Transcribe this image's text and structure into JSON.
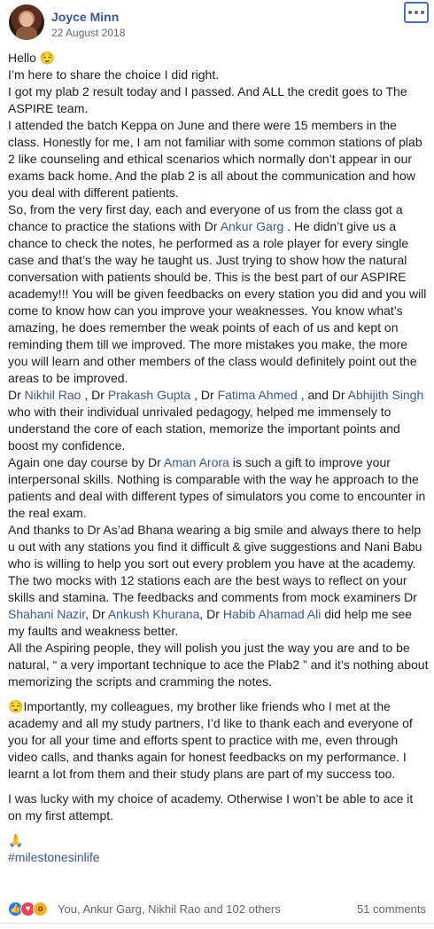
{
  "post": {
    "author": "Joyce Minn",
    "date": "22 August 2018",
    "paragraphs": [
      [
        {
          "t": "Hello "
        },
        {
          "t": "😌",
          "emoji": true
        }
      ],
      [
        {
          "t": "I’m here to share the choice I did right."
        }
      ],
      [
        {
          "t": "I got my plab 2 result today and I passed. And ALL the credit goes to The ASPIRE team."
        }
      ],
      [
        {
          "t": "I attended the batch Keppa on June and there were 15 members in the class. Honestly for me, I am not familiar with some common stations of plab 2 like counseling and ethical scenarios which normally don’t appear in our exams back home. And the plab 2 is all about the communication and how you deal with different patients."
        }
      ],
      [
        {
          "t": "So, from the very first day, each and everyone of us from the class got a chance to practice the stations with Dr "
        },
        {
          "t": "Ankur Garg",
          "link": true
        },
        {
          "t": " . He didn’t give us a chance to check the notes, he performed as a role player for every single case and that’s the way he taught us. Just trying to show how the natural conversation with patients should be. This is the best part of our ASPIRE academy!!! You will be given feedbacks on every station you did and you will come to know how can you improve your weaknesses. You know what’s amazing, he does remember the weak points of each of us and kept on reminding them till we improved. The more mistakes you make, the more you will learn and other members of the class would definitely point out the areas to be improved."
        }
      ],
      [
        {
          "t": "Dr "
        },
        {
          "t": "Nikhil Rao",
          "link": true
        },
        {
          "t": " , Dr "
        },
        {
          "t": "Prakash Gupta",
          "link": true
        },
        {
          "t": " , Dr "
        },
        {
          "t": "Fatima Ahmed",
          "link": true
        },
        {
          "t": " , and Dr "
        },
        {
          "t": "Abhijith Singh",
          "link": true
        },
        {
          "t": " who with their individual unrivaled pedagogy, helped me immensely to understand the core of each station, memorize the important points and boost my confidence."
        }
      ],
      [
        {
          "t": "Again one day course by Dr "
        },
        {
          "t": "Aman Arora",
          "link": true
        },
        {
          "t": " is such a gift to improve your interpersonal skills. Nothing is comparable with the way he approach to the patients and deal with different types of simulators you come to encounter in the real exam."
        }
      ],
      [
        {
          "t": "And thanks to Dr As’ad Bhana wearing a big smile and always there to help u out with any stations you find it difficult & give suggestions and Nani Babu who is willing to help you sort out every problem you have at the academy."
        }
      ],
      [
        {
          "t": "The two mocks with 12 stations each are the best ways to reflect on your skills and stamina. The feedbacks and comments from mock examiners Dr "
        },
        {
          "t": "Shahani Nazir",
          "link": true
        },
        {
          "t": ", Dr "
        },
        {
          "t": "Ankush Khurana",
          "link": true
        },
        {
          "t": ", Dr "
        },
        {
          "t": "Habib Ahamad Ali",
          "link": true
        },
        {
          "t": " did help me see my faults and weakness better."
        }
      ],
      [
        {
          "t": "All the Aspiring people, they will polish you just the way you are and to be natural, “ a very important technique to ace the Plab2 ” and it’s nothing about memorizing the scripts and cramming the notes."
        }
      ],
      [
        {
          "t": "😌",
          "emoji": true
        },
        {
          "t": "Importantly, my colleagues, my brother like friends who I met at the academy and all my study partners, I’d like to thank each and everyone of you for all your time and efforts spent to practice with me, even through video calls, and thanks again for honest feedbacks on my performance. I learnt a lot from them and their study plans are part of my success too."
        }
      ],
      [
        {
          "t": "I was lucky with my choice of academy. Otherwise I won’t be able to ace it on my first attempt."
        }
      ],
      [
        {
          "t": "🙏",
          "emoji": true
        }
      ],
      [
        {
          "t": "#milestonesinlife",
          "hashtag": true
        }
      ]
    ],
    "gap_before": [
      10,
      11,
      12
    ]
  },
  "footer": {
    "reactions_text": "You, Ankur Garg, Nikhil Rao and 102 others",
    "comments": "51 comments",
    "reaction_icons": [
      "like-icon",
      "love-icon",
      "wow-icon"
    ]
  },
  "colors": {
    "link": "#385898",
    "author": "#365899",
    "text": "#1c1e21",
    "muted": "#606770"
  }
}
